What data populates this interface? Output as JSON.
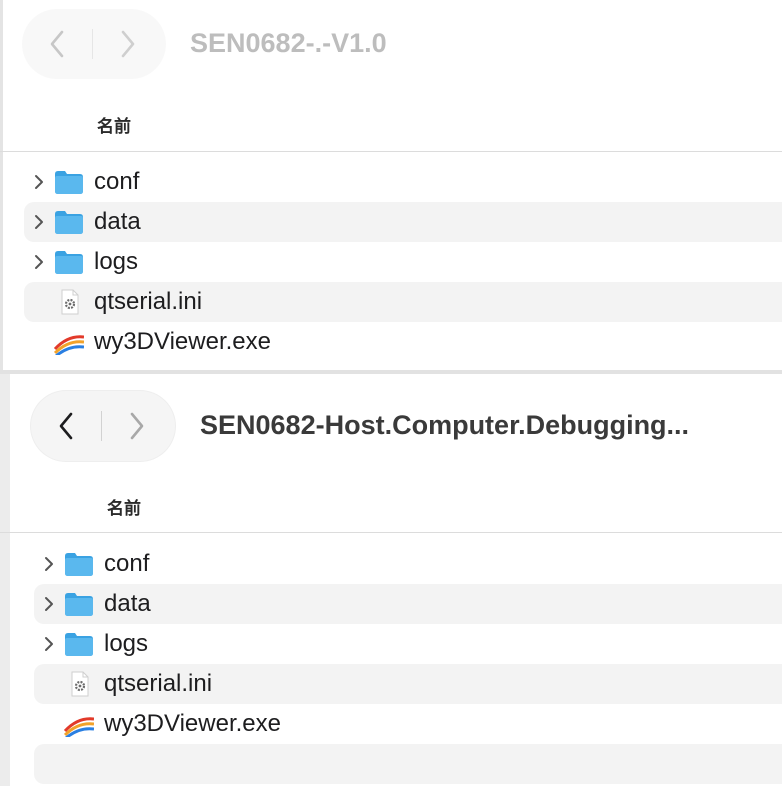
{
  "colors": {
    "folder": "#5ab8ee",
    "folder_dark": "#3aa2e2",
    "chevron": "#555555",
    "nav_glyph": "#1d1d1f"
  },
  "windows": [
    {
      "title": "SEN0682-.-V1.0",
      "column_header": "名前",
      "items": [
        {
          "name": "conf",
          "icon": "folder-icon",
          "expandable": true
        },
        {
          "name": "data",
          "icon": "folder-icon",
          "expandable": true
        },
        {
          "name": "logs",
          "icon": "folder-icon",
          "expandable": true
        },
        {
          "name": "qtserial.ini",
          "icon": "gear-document-icon",
          "expandable": false
        },
        {
          "name": "wy3DViewer.exe",
          "icon": "exe-app-icon",
          "expandable": false
        }
      ]
    },
    {
      "title": "SEN0682-Host.Computer.Debugging...",
      "column_header": "名前",
      "items": [
        {
          "name": "conf",
          "icon": "folder-icon",
          "expandable": true
        },
        {
          "name": "data",
          "icon": "folder-icon",
          "expandable": true
        },
        {
          "name": "logs",
          "icon": "folder-icon",
          "expandable": true
        },
        {
          "name": "qtserial.ini",
          "icon": "gear-document-icon",
          "expandable": false
        },
        {
          "name": "wy3DViewer.exe",
          "icon": "exe-app-icon",
          "expandable": false
        }
      ]
    }
  ]
}
